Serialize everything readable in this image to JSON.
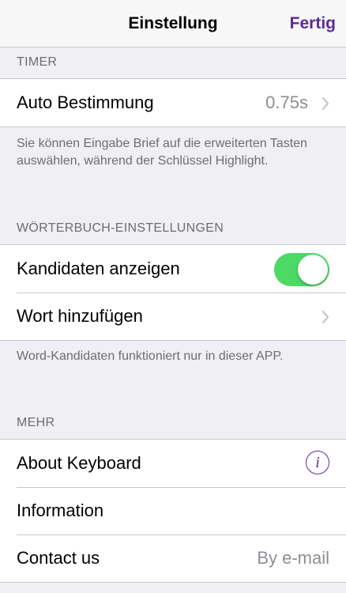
{
  "colors": {
    "accent": "#5b2b97",
    "toggle_on": "#4cd964",
    "background": "#efeff4"
  },
  "navbar": {
    "title": "Einstellung",
    "done_label": "Fertig"
  },
  "timer": {
    "header": "TIMER",
    "rows": [
      {
        "label": "Auto Bestimmung",
        "value": "0.75s",
        "icon": "chevron-right-icon"
      }
    ],
    "footer": "Sie können Eingabe Brief auf die erweiterten Tasten auswählen, während der Schlüssel Highlight."
  },
  "dictionary": {
    "header": "WÖRTERBUCH-EINSTELLUNGEN",
    "rows": [
      {
        "label": "Kandidaten anzeigen",
        "toggle_on": true
      },
      {
        "label": "Wort hinzufügen",
        "icon": "chevron-right-icon"
      }
    ],
    "footer": "Word-Kandidaten funktioniert nur in dieser APP."
  },
  "more": {
    "header": "MEHR",
    "rows": [
      {
        "label": "About Keyboard",
        "icon": "info-icon",
        "icon_glyph": "i"
      },
      {
        "label": "Information"
      },
      {
        "label": "Contact us",
        "value": "By e-mail"
      }
    ]
  }
}
